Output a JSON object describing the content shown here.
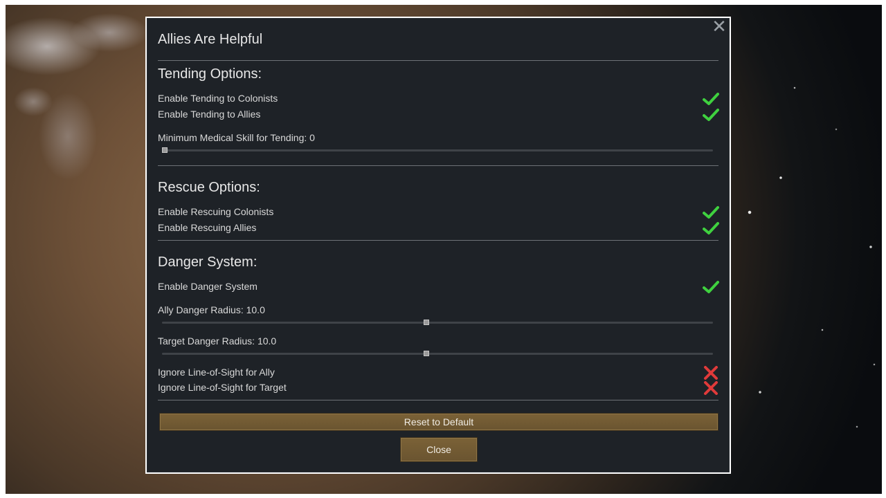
{
  "dialog": {
    "title": "Allies Are Helpful",
    "close_icon_glyph": "✕"
  },
  "tending": {
    "heading": "Tending Options:",
    "options": [
      {
        "label": "Enable Tending to Colonists",
        "enabled": true,
        "icon": "checkmark-icon"
      },
      {
        "label": "Enable Tending to Allies",
        "enabled": true,
        "icon": "checkmark-icon"
      }
    ],
    "min_skill_label": "Minimum Medical Skill for Tending: 0",
    "min_skill_level": 0
  },
  "rescue": {
    "heading": "Rescue Options:",
    "options": [
      {
        "label": "Enable Rescuing Colonists",
        "enabled": true,
        "icon": "checkmark-icon"
      },
      {
        "label": "Enable Rescuing Allies",
        "enabled": true,
        "icon": "checkmark-icon"
      }
    ]
  },
  "danger": {
    "heading": "Danger System:",
    "enable_label": "Enable Danger System",
    "enabled": true,
    "ally_radius_label": "Ally Danger Radius: 10.0",
    "ally_radius_level": 0.48,
    "target_radius_label": "Target Danger Radius: 10.0",
    "target_radius_level": 0.48,
    "los": [
      {
        "label": "Ignore Line-of-Sight for Ally",
        "enabled": false,
        "icon": "cross-icon"
      },
      {
        "label": "Ignore Line-of-Sight for Target",
        "enabled": false,
        "icon": "cross-icon"
      }
    ]
  },
  "buttons": {
    "reset_label": "Reset to Default",
    "close_label": "Close"
  },
  "colors": {
    "check": "#3fd13f",
    "cross": "#e03a3a",
    "button": "#74603a",
    "panel": "#1e2227"
  }
}
